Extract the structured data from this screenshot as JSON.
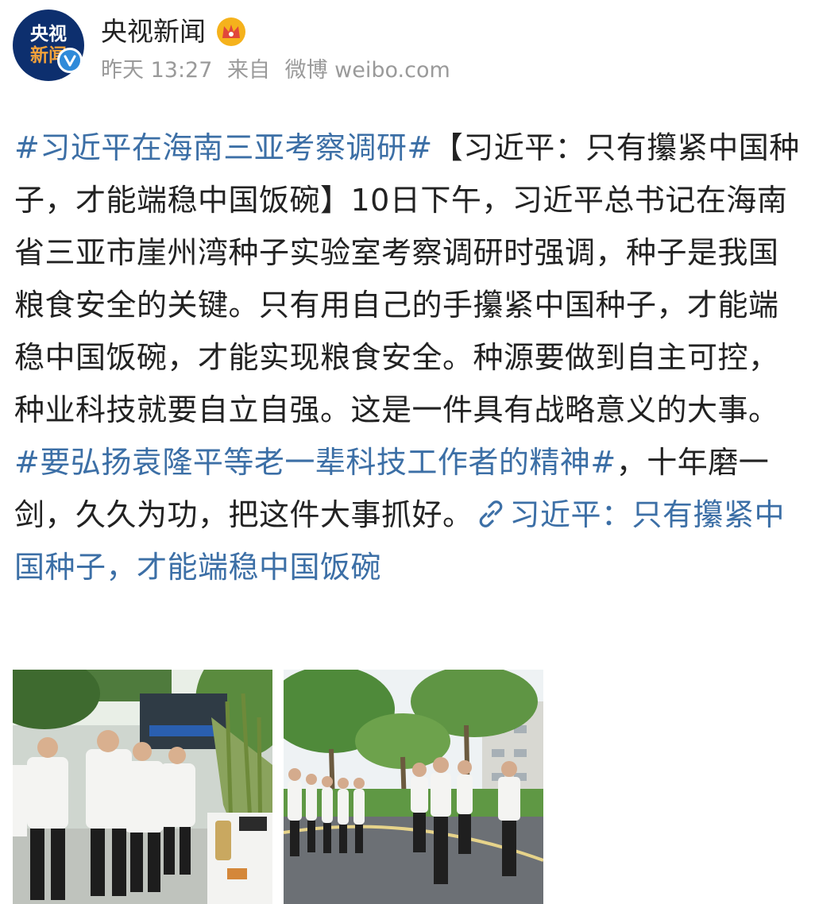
{
  "account": {
    "avatar_line1": "央视",
    "avatar_line2": "新闻",
    "name": "央视新闻",
    "time": "昨天 13:27",
    "source_prefix": "来自",
    "source_name": "微博 weibo.com"
  },
  "post": {
    "topic1": "#习近平在海南三亚考察调研#",
    "text1": "【习近平：只有攥紧中国种子，才能端稳中国饭碗】10日下午，习近平总书记在海南省三亚市崖州湾种子实验室考察调研时强调，种子是我国粮食安全的关键。只有用自己的手攥紧中国种子，才能端稳中国饭碗，才能实现粮食安全。种源要做到自主可控，种业科技就要自立自强。这是一件具有战略意义的大事。",
    "topic2": "#要弘扬袁隆平等老一辈科技工作者的精神#",
    "text2": "，十年磨一剑，久久为功，把这件大事抓好。",
    "link_text": "习近平：只有攥紧中国种子，才能端稳中国饭碗"
  },
  "photos": [
    {
      "icon": "photo-visit-lab-entrance"
    },
    {
      "icon": "photo-visit-outdoor-path"
    }
  ],
  "colors": {
    "link": "#3c6fa6",
    "meta": "#9a9a9a",
    "avatar_bg": "#0d2f6e",
    "verified": "#2f8ad9"
  }
}
